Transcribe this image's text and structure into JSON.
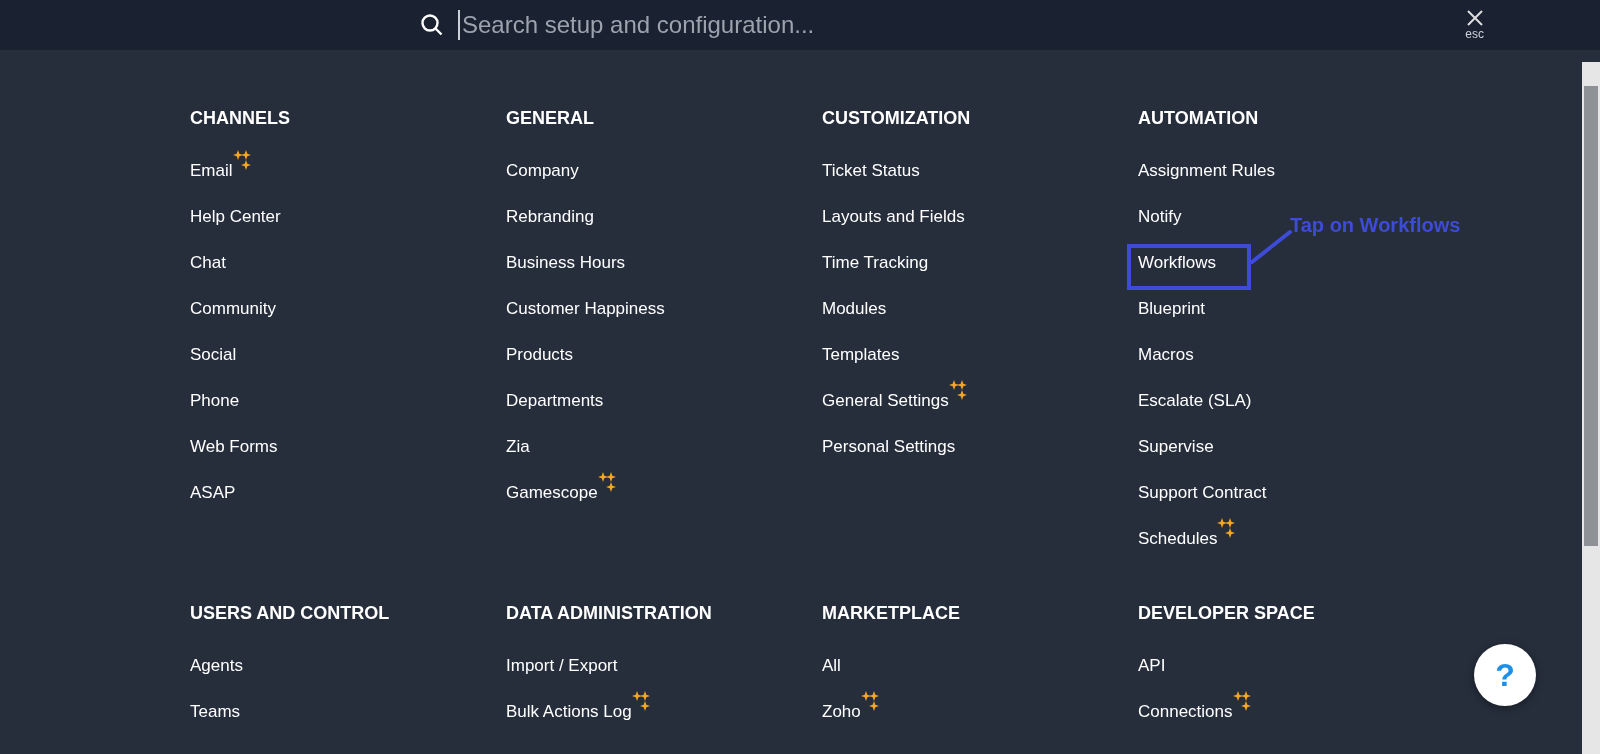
{
  "setup_search": {
    "placeholder": "Search setup and configuration...",
    "close_hint": "esc"
  },
  "sections": [
    {
      "title": "CHANNELS",
      "items": [
        {
          "label": "Email",
          "new": true,
          "highlighted": false
        },
        {
          "label": "Help Center",
          "new": false,
          "highlighted": false
        },
        {
          "label": "Chat",
          "new": false,
          "highlighted": false
        },
        {
          "label": "Community",
          "new": false,
          "highlighted": false
        },
        {
          "label": "Social",
          "new": false,
          "highlighted": false
        },
        {
          "label": "Phone",
          "new": false,
          "highlighted": false
        },
        {
          "label": "Web Forms",
          "new": false,
          "highlighted": false
        },
        {
          "label": "ASAP",
          "new": false,
          "highlighted": false
        }
      ]
    },
    {
      "title": "GENERAL",
      "items": [
        {
          "label": "Company",
          "new": false,
          "highlighted": false
        },
        {
          "label": "Rebranding",
          "new": false,
          "highlighted": false
        },
        {
          "label": "Business Hours",
          "new": false,
          "highlighted": false
        },
        {
          "label": "Customer Happiness",
          "new": false,
          "highlighted": false
        },
        {
          "label": "Products",
          "new": false,
          "highlighted": false
        },
        {
          "label": "Departments",
          "new": false,
          "highlighted": false
        },
        {
          "label": "Zia",
          "new": false,
          "highlighted": false
        },
        {
          "label": "Gamescope",
          "new": true,
          "highlighted": false
        }
      ]
    },
    {
      "title": "CUSTOMIZATION",
      "items": [
        {
          "label": "Ticket Status",
          "new": false,
          "highlighted": false
        },
        {
          "label": "Layouts and Fields",
          "new": false,
          "highlighted": false
        },
        {
          "label": "Time Tracking",
          "new": false,
          "highlighted": false
        },
        {
          "label": "Modules",
          "new": false,
          "highlighted": false
        },
        {
          "label": "Templates",
          "new": false,
          "highlighted": false
        },
        {
          "label": "General Settings",
          "new": true,
          "highlighted": false
        },
        {
          "label": "Personal Settings",
          "new": false,
          "highlighted": false
        }
      ]
    },
    {
      "title": "AUTOMATION",
      "items": [
        {
          "label": "Assignment Rules",
          "new": false,
          "highlighted": false
        },
        {
          "label": "Notify",
          "new": false,
          "highlighted": false
        },
        {
          "label": "Workflows",
          "new": false,
          "highlighted": true
        },
        {
          "label": "Blueprint",
          "new": false,
          "highlighted": false
        },
        {
          "label": "Macros",
          "new": false,
          "highlighted": false
        },
        {
          "label": "Escalate (SLA)",
          "new": false,
          "highlighted": false
        },
        {
          "label": "Supervise",
          "new": false,
          "highlighted": false
        },
        {
          "label": "Support Contract",
          "new": false,
          "highlighted": false
        },
        {
          "label": "Schedules",
          "new": true,
          "highlighted": false
        }
      ]
    },
    {
      "title": "USERS AND CONTROL",
      "items": [
        {
          "label": "Agents",
          "new": false,
          "highlighted": false
        },
        {
          "label": "Teams",
          "new": false,
          "highlighted": false
        }
      ]
    },
    {
      "title": "DATA ADMINISTRATION",
      "items": [
        {
          "label": "Import / Export",
          "new": false,
          "highlighted": false
        },
        {
          "label": "Bulk Actions Log",
          "new": true,
          "highlighted": false
        }
      ]
    },
    {
      "title": "MARKETPLACE",
      "items": [
        {
          "label": "All",
          "new": false,
          "highlighted": false
        },
        {
          "label": "Zoho",
          "new": true,
          "highlighted": false
        }
      ]
    },
    {
      "title": "DEVELOPER SPACE",
      "items": [
        {
          "label": "API",
          "new": false,
          "highlighted": false
        },
        {
          "label": "Connections",
          "new": true,
          "highlighted": false
        }
      ]
    }
  ],
  "annotation": {
    "label": "Tap on Workflows"
  },
  "help": {
    "label": "?"
  }
}
